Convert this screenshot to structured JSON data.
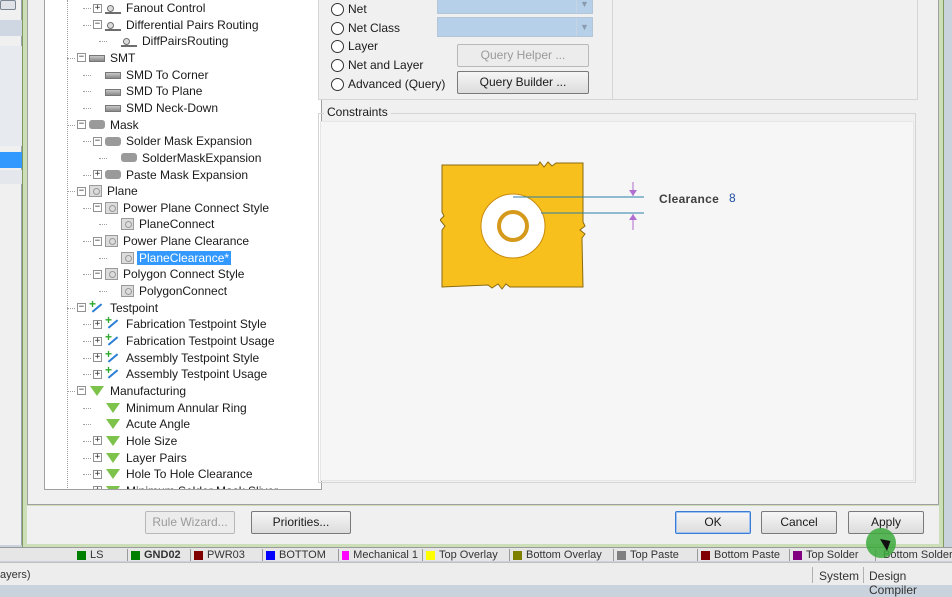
{
  "tree": {
    "items": [
      {
        "label": "Fanout Control",
        "level": 2,
        "icon": "routing-icon",
        "expander": "+"
      },
      {
        "label": "Differential Pairs Routing",
        "level": 2,
        "icon": "routing-icon",
        "expander": "-"
      },
      {
        "label": "DiffPairsRouting",
        "level": 3,
        "icon": "routing-icon",
        "expander": ""
      },
      {
        "label": "SMT",
        "level": 1,
        "icon": "smt-icon",
        "expander": "-"
      },
      {
        "label": "SMD To Corner",
        "level": 2,
        "icon": "smt-icon",
        "expander": ""
      },
      {
        "label": "SMD To Plane",
        "level": 2,
        "icon": "smt-icon",
        "expander": ""
      },
      {
        "label": "SMD Neck-Down",
        "level": 2,
        "icon": "smt-icon",
        "expander": ""
      },
      {
        "label": "Mask",
        "level": 1,
        "icon": "mask-icon",
        "expander": "-"
      },
      {
        "label": "Solder Mask Expansion",
        "level": 2,
        "icon": "mask-icon",
        "expander": "-"
      },
      {
        "label": "SolderMaskExpansion",
        "level": 3,
        "icon": "mask-icon",
        "expander": ""
      },
      {
        "label": "Paste Mask Expansion",
        "level": 2,
        "icon": "mask-icon",
        "expander": "+"
      },
      {
        "label": "Plane",
        "level": 1,
        "icon": "plane-icon",
        "expander": "-"
      },
      {
        "label": "Power Plane Connect Style",
        "level": 2,
        "icon": "plane-icon",
        "expander": "-"
      },
      {
        "label": "PlaneConnect",
        "level": 3,
        "icon": "plane-icon",
        "expander": ""
      },
      {
        "label": "Power Plane Clearance",
        "level": 2,
        "icon": "plane-icon",
        "expander": "-"
      },
      {
        "label": "PlaneClearance*",
        "level": 3,
        "icon": "plane-icon",
        "expander": "",
        "selected": true
      },
      {
        "label": "Polygon Connect Style",
        "level": 2,
        "icon": "plane-icon",
        "expander": "-"
      },
      {
        "label": "PolygonConnect",
        "level": 3,
        "icon": "plane-icon",
        "expander": ""
      },
      {
        "label": "Testpoint",
        "level": 1,
        "icon": "testpoint-icon",
        "expander": "-"
      },
      {
        "label": "Fabrication Testpoint Style",
        "level": 2,
        "icon": "testpoint-icon",
        "expander": "+"
      },
      {
        "label": "Fabrication Testpoint Usage",
        "level": 2,
        "icon": "testpoint-icon",
        "expander": "+"
      },
      {
        "label": "Assembly Testpoint Style",
        "level": 2,
        "icon": "testpoint-icon",
        "expander": "+"
      },
      {
        "label": "Assembly Testpoint Usage",
        "level": 2,
        "icon": "testpoint-icon",
        "expander": "+"
      },
      {
        "label": "Manufacturing",
        "level": 1,
        "icon": "manufacturing-icon",
        "expander": "-"
      },
      {
        "label": "Minimum Annular Ring",
        "level": 2,
        "icon": "manufacturing-icon",
        "expander": ""
      },
      {
        "label": "Acute Angle",
        "level": 2,
        "icon": "manufacturing-icon",
        "expander": ""
      },
      {
        "label": "Hole Size",
        "level": 2,
        "icon": "manufacturing-icon",
        "expander": "+"
      },
      {
        "label": "Layer Pairs",
        "level": 2,
        "icon": "manufacturing-icon",
        "expander": "+"
      },
      {
        "label": "Hole To Hole Clearance",
        "level": 2,
        "icon": "manufacturing-icon",
        "expander": "+"
      },
      {
        "label": "Minimum Solder Mask Sliver",
        "level": 2,
        "icon": "manufacturing-icon",
        "expander": "+"
      }
    ]
  },
  "scope": {
    "options": [
      "Net",
      "Net Class",
      "Layer",
      "Net and Layer",
      "Advanced (Query)"
    ],
    "query_helper_label": "Query Helper ...",
    "query_builder_label": "Query Builder ..."
  },
  "constraints": {
    "group_label": "Constraints",
    "clearance_label": "Clearance",
    "clearance_value": "8"
  },
  "buttons": {
    "rule_wizard": "Rule Wizard...",
    "priorities": "Priorities...",
    "ok": "OK",
    "cancel": "Cancel",
    "apply": "Apply"
  },
  "layer_tabs": [
    {
      "label": "LS",
      "color": "#008000"
    },
    {
      "label": "GND02",
      "color": "#008000"
    },
    {
      "label": "PWR03",
      "color": "#800000"
    },
    {
      "label": "BOTTOM",
      "color": "#0000ff"
    },
    {
      "label": "Mechanical 1",
      "color": "#ff00ff"
    },
    {
      "label": "Top Overlay",
      "color": "#ffff00"
    },
    {
      "label": "Bottom Overlay",
      "color": "#808000"
    },
    {
      "label": "Top Paste",
      "color": "#808080"
    },
    {
      "label": "Bottom Paste",
      "color": "#800000"
    },
    {
      "label": "Top Solder",
      "color": "#800080"
    },
    {
      "label": "Bottom Solder",
      "color": "#ff00ff"
    }
  ],
  "status": {
    "left_text": "ayers)",
    "system": "System",
    "design_compiler": "Design Compiler"
  },
  "colors": {
    "accent_selection": "#3399ff",
    "plane_copper": "#f8c01c",
    "dialog_frame": "#cddfb8"
  }
}
